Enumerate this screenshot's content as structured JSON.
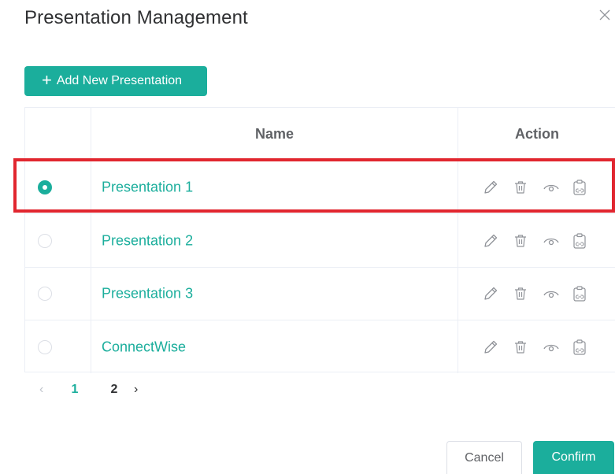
{
  "dialog": {
    "title": "Presentation Management",
    "close_icon": "close-icon"
  },
  "toolbar": {
    "add_label": "Add New Presentation",
    "add_icon": "plus-icon"
  },
  "table": {
    "columns": {
      "name": "Name",
      "action": "Action"
    },
    "rows": [
      {
        "name": "Presentation 1",
        "selected": true
      },
      {
        "name": "Presentation 2",
        "selected": false
      },
      {
        "name": "Presentation 3",
        "selected": false
      },
      {
        "name": "ConnectWise",
        "selected": false
      }
    ],
    "action_icons": [
      "edit-icon",
      "delete-icon",
      "view-icon",
      "copy-link-icon"
    ]
  },
  "pagination": {
    "prev": "‹",
    "pages": [
      "1",
      "2"
    ],
    "current": "1",
    "next": "›"
  },
  "footer": {
    "cancel_label": "Cancel",
    "confirm_label": "Confirm"
  },
  "colors": {
    "accent": "#1bae9c",
    "highlight": "#e1262f"
  }
}
